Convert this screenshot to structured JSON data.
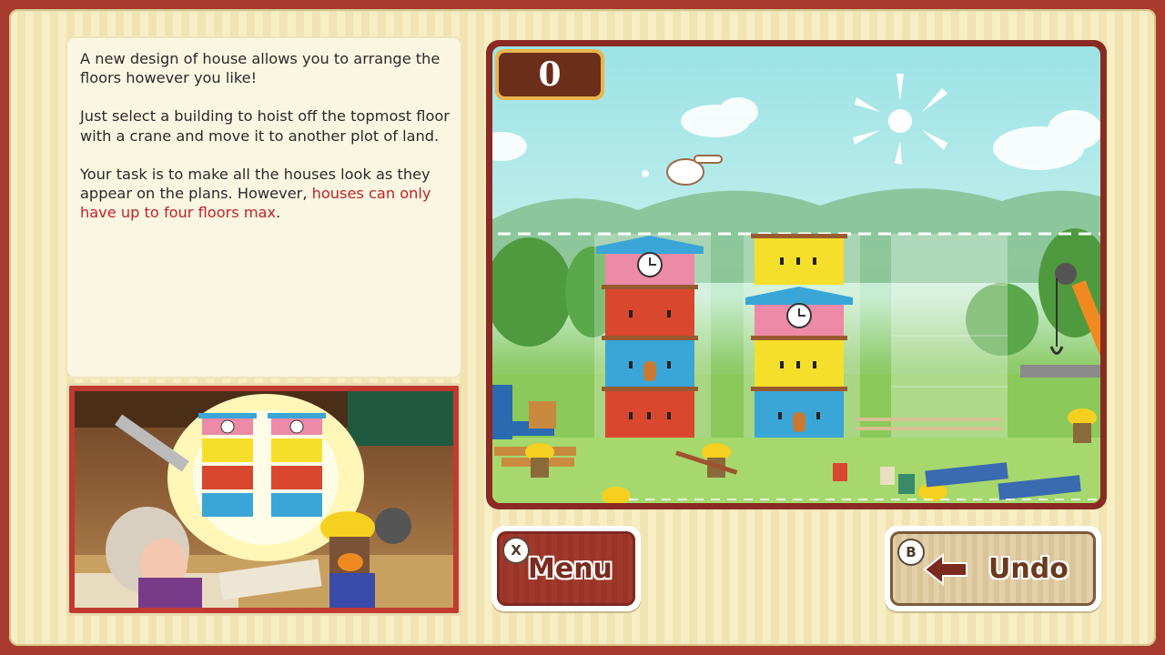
{
  "instructions": {
    "p1": "A new design of house allows you to arrange the floors however you like!",
    "p2": "Just select a building to hoist off the topmost floor with a crane and move it to another plot of land.",
    "p3_a": "Your task is to make all the houses look as they appear on the plans. However, ",
    "p3_highlight": "houses can only have up to four floors max",
    "p3_end": "."
  },
  "score": "0",
  "buttons": {
    "menu": {
      "key": "X",
      "label": "Menu"
    },
    "undo": {
      "key": "B",
      "label": "Undo"
    }
  },
  "colors": {
    "frame": "#a83a2e",
    "highlight_text": "#c0212a",
    "pink_floor": "#ec8aa8",
    "red_floor": "#d9472e",
    "blue_floor": "#3aa6d8",
    "yellow_floor": "#f6df2a"
  },
  "plots": [
    {
      "floors": [
        "red",
        "blue",
        "red"
      ],
      "roof": "pink-clock"
    },
    {
      "floors": [
        "blue",
        "yellow"
      ],
      "roof": "pink-clock",
      "top_extra": "yellow"
    },
    {
      "floors": [],
      "roof": "none"
    }
  ],
  "plans": [
    {
      "floors": [
        "blue",
        "red",
        "yellow"
      ],
      "roof": "pink-clock"
    },
    {
      "floors": [
        "blue",
        "red",
        "yellow"
      ],
      "roof": "pink-clock"
    }
  ]
}
